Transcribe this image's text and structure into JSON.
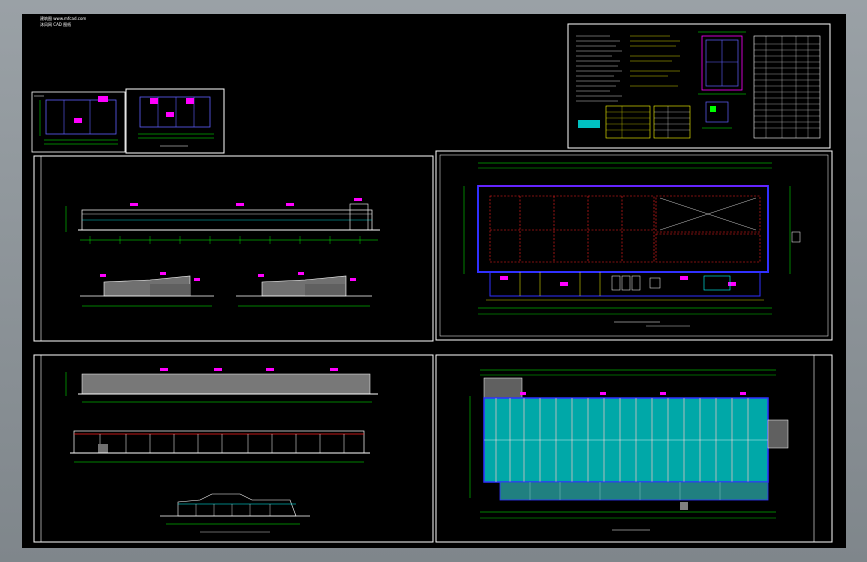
{
  "title_block": {
    "line1": "建筑图 www.mfcad.com",
    "line2": "沐风网 CAD 图纸"
  },
  "colors": {
    "background": "#000000",
    "frame": "#ffffff",
    "axis": "#00ff00",
    "dim": "#ff00ff",
    "wall": "#0000ff",
    "grid": "#ff0000",
    "fill": "#808080",
    "roof_fill": "#00a0a0",
    "yellow": "#ffff00",
    "cyan": "#00ffff"
  },
  "sheets": [
    {
      "id": "detail-small-a",
      "name": "detail-sheet-a"
    },
    {
      "id": "detail-small-b",
      "name": "detail-sheet-b"
    },
    {
      "id": "notes-sheet",
      "name": "design-notes-sheet"
    },
    {
      "id": "elevations-sheet",
      "name": "elevations-sheet"
    },
    {
      "id": "floor-plan-sheet",
      "name": "floor-plan-sheet"
    },
    {
      "id": "sections-sheet",
      "name": "sections-sheet"
    },
    {
      "id": "roof-plan-sheet",
      "name": "roof-plan-sheet"
    }
  ]
}
